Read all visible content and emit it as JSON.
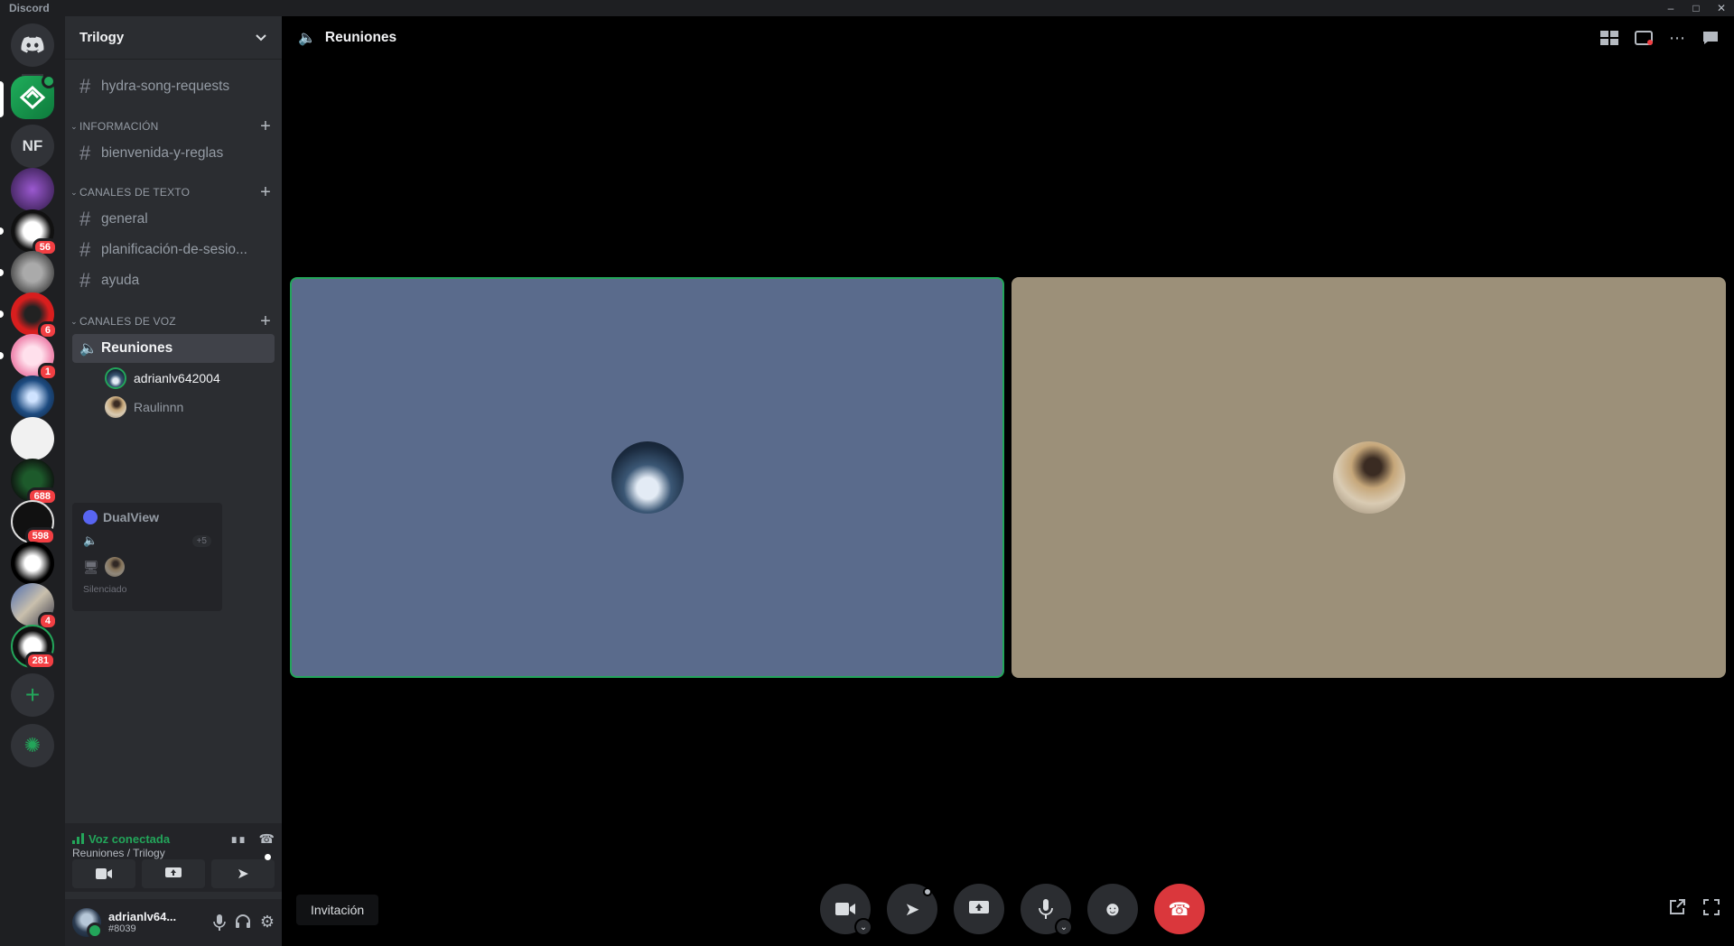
{
  "window": {
    "title": "Discord"
  },
  "guild": {
    "name": "Trilogy"
  },
  "servers": [
    {
      "label": "",
      "badge": ""
    },
    {
      "label": "NF",
      "badge": ""
    },
    {
      "label": "",
      "badge": ""
    },
    {
      "label": "",
      "badge": "56"
    },
    {
      "label": "",
      "badge": ""
    },
    {
      "label": "",
      "badge": "6"
    },
    {
      "label": "",
      "badge": "1"
    },
    {
      "label": "",
      "badge": ""
    },
    {
      "label": "",
      "badge": ""
    },
    {
      "label": "",
      "badge": "688"
    },
    {
      "label": "",
      "badge": "598"
    },
    {
      "label": "",
      "badge": ""
    },
    {
      "label": "",
      "badge": "4"
    },
    {
      "label": "",
      "badge": "281"
    }
  ],
  "channels": {
    "top": "hydra-song-requests",
    "cat_info": "INFORMACIÓN",
    "info_1": "bienvenida-y-reglas",
    "cat_text": "CANALES DE TEXTO",
    "text_1": "general",
    "text_2": "planificación-de-sesio...",
    "text_3": "ayuda",
    "cat_voice": "CANALES DE VOZ",
    "voice_1": "Reuniones",
    "voice_users": [
      "adrianlv642004",
      "Raulinnn"
    ]
  },
  "popout": {
    "title": "DualView",
    "count": "+5",
    "status": "Silenciado"
  },
  "voice_panel": {
    "status": "Voz conectada",
    "location": "Reuniones / Trilogy"
  },
  "user": {
    "name": "adrianlv64...",
    "tag": "#8039"
  },
  "main": {
    "channel_title": "Reuniones",
    "invite_label": "Invitación"
  },
  "colors": {
    "connected": "#23a55a",
    "end_call": "#da373c",
    "tile_a": "#5a6b8c",
    "tile_b": "#9c9079"
  }
}
